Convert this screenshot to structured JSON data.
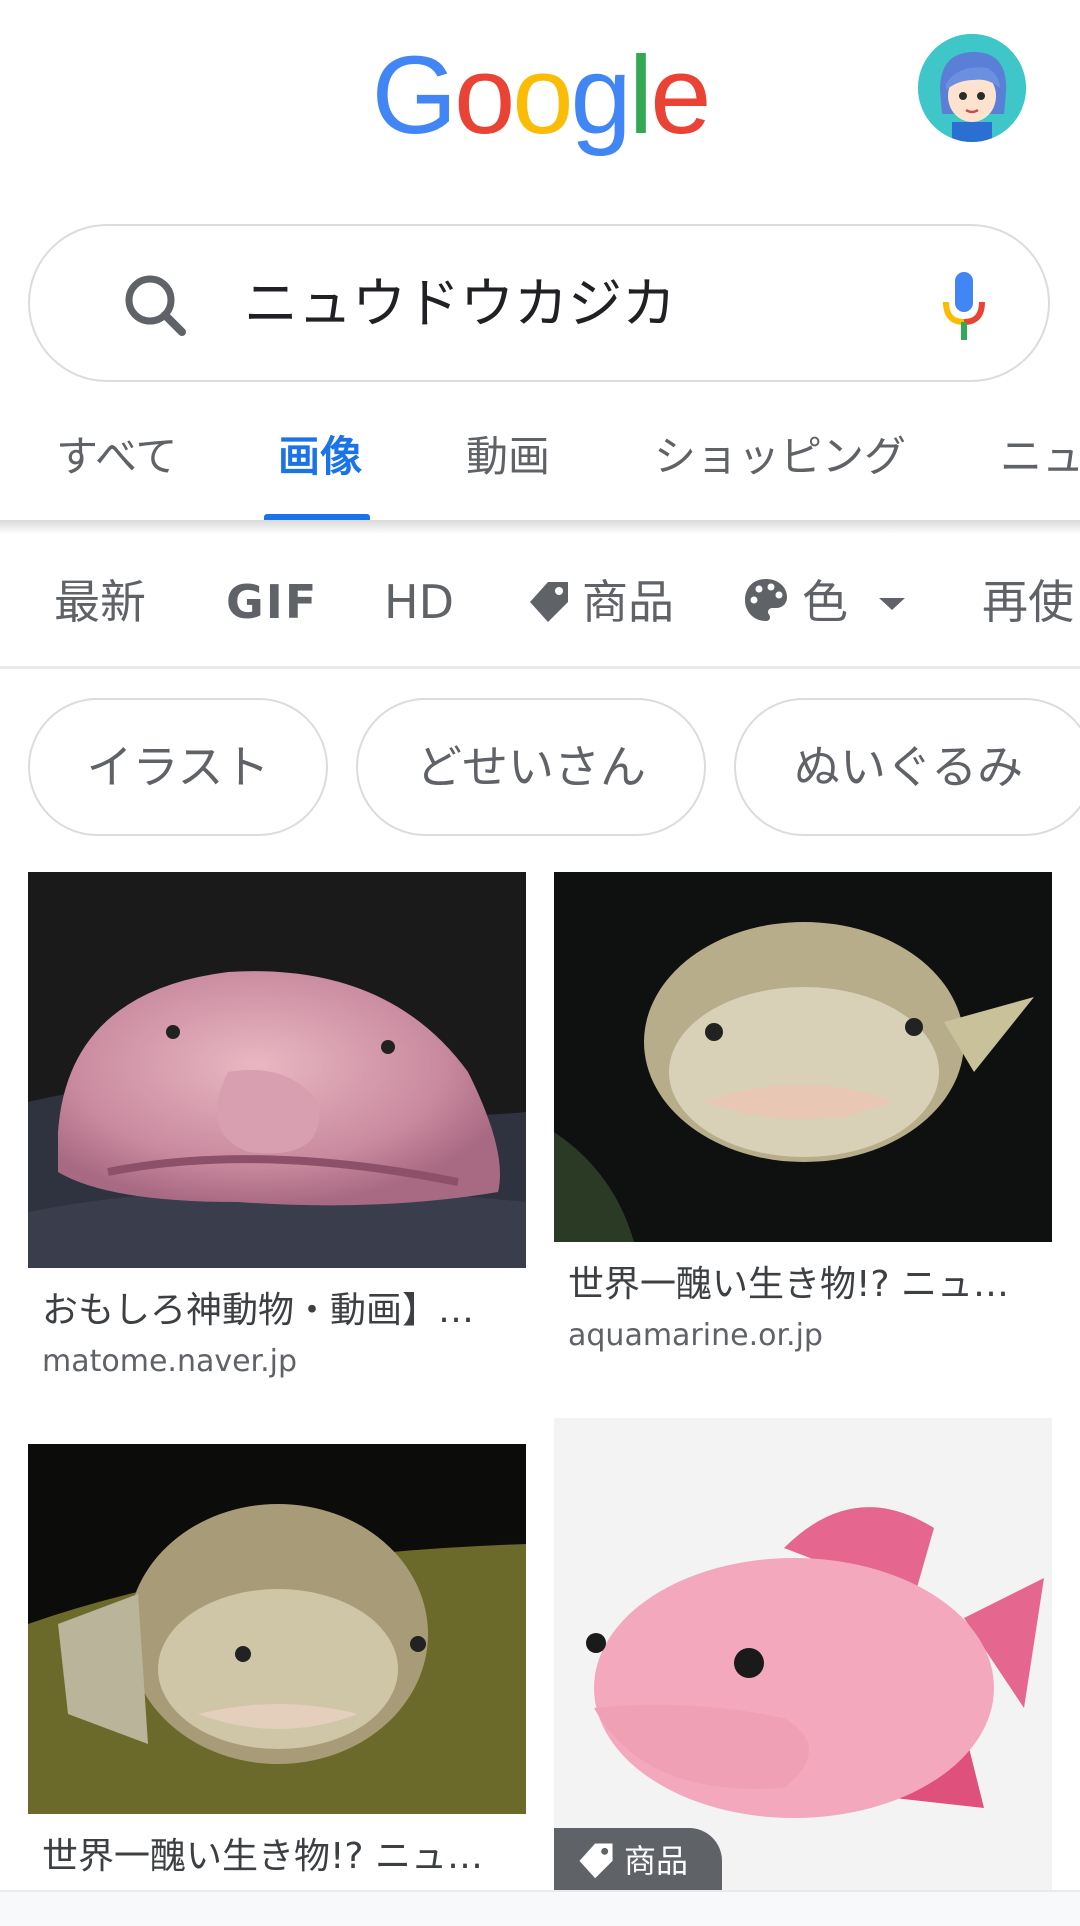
{
  "header": {
    "logo_letters": [
      "G",
      "o",
      "o",
      "g",
      "l",
      "e"
    ],
    "logo_colors": [
      "#4285F4",
      "#EA4335",
      "#FBBC05",
      "#4285F4",
      "#34A853",
      "#EA4335"
    ]
  },
  "search": {
    "query": "ニュウドウカジカ"
  },
  "tabs": [
    {
      "label": "すべて",
      "active": false
    },
    {
      "label": "画像",
      "active": true
    },
    {
      "label": "動画",
      "active": false
    },
    {
      "label": "ショッピング",
      "active": false
    },
    {
      "label": "ニュ",
      "active": false
    }
  ],
  "tools": [
    {
      "label": "最新",
      "icon": ""
    },
    {
      "label": "GIF",
      "icon": ""
    },
    {
      "label": "HD",
      "icon": ""
    },
    {
      "label": "商品",
      "icon": "tag-icon"
    },
    {
      "label": "色",
      "icon": "palette-icon"
    },
    {
      "label": "再使",
      "icon": ""
    }
  ],
  "chips": [
    "イラスト",
    "どせいさん",
    "ぬいぐるみ"
  ],
  "results": [
    {
      "caption": "おもしろ神動物・動画】…",
      "domain": "matome.naver.jp"
    },
    {
      "caption": "世界一醜い生き物!? ニュ…",
      "domain": "aquamarine.or.jp"
    },
    {
      "caption": "世界一醜い生き物!? ニュ…",
      "domain": ""
    },
    {
      "caption": "",
      "domain": "",
      "badge": "商品"
    }
  ],
  "colors": {
    "accent": "#1a73e8",
    "text_secondary": "#5f6368",
    "border": "#dadce0"
  }
}
